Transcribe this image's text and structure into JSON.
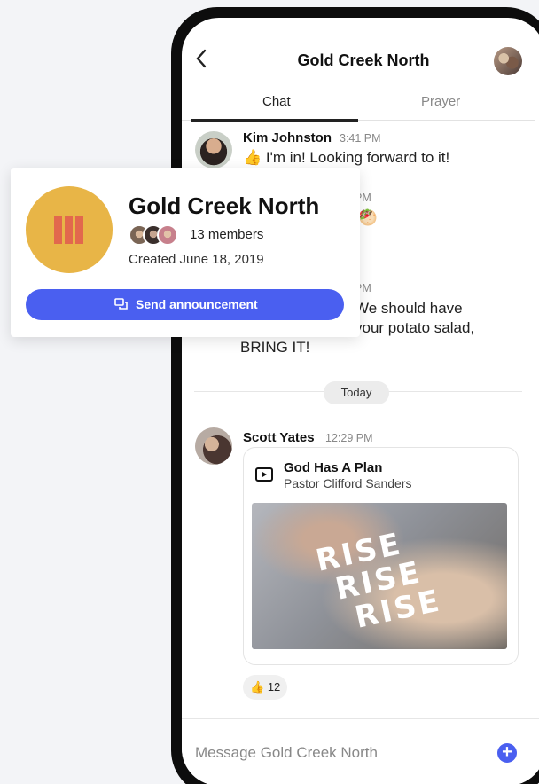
{
  "chat_header": {
    "title": "Gold Creek North"
  },
  "tabs": [
    {
      "label": "Chat"
    },
    {
      "label": "Prayer"
    }
  ],
  "messages": [
    {
      "name": "Kim Johnston",
      "time": "3:41 PM",
      "text": "👍 I'm in! Looking forward to it!"
    },
    {
      "time_fragment": "PM",
      "text_fragment": "! 🥙"
    },
    {
      "time_fragment": "PM",
      "line1": "We should have",
      "line2": "your potato salad,",
      "line3": "BRING IT!"
    }
  ],
  "day_divider": "Today",
  "post": {
    "name": "Scott Yates",
    "time": "12:29 PM",
    "media_title": "God Has A Plan",
    "media_author": "Pastor Clifford Sanders",
    "image_words": [
      "RISE",
      "RISE",
      "RISE"
    ],
    "reaction_emoji": "👍",
    "reaction_count": "12"
  },
  "composer": {
    "placeholder": "Message Gold Creek North",
    "add_label": "+"
  },
  "group_card": {
    "title": "Gold Creek North",
    "members": "13 members",
    "created": "Created June 18, 2019",
    "button": "Send announcement",
    "icon_color": "#e8b547",
    "accent": "#4a5ff0"
  }
}
